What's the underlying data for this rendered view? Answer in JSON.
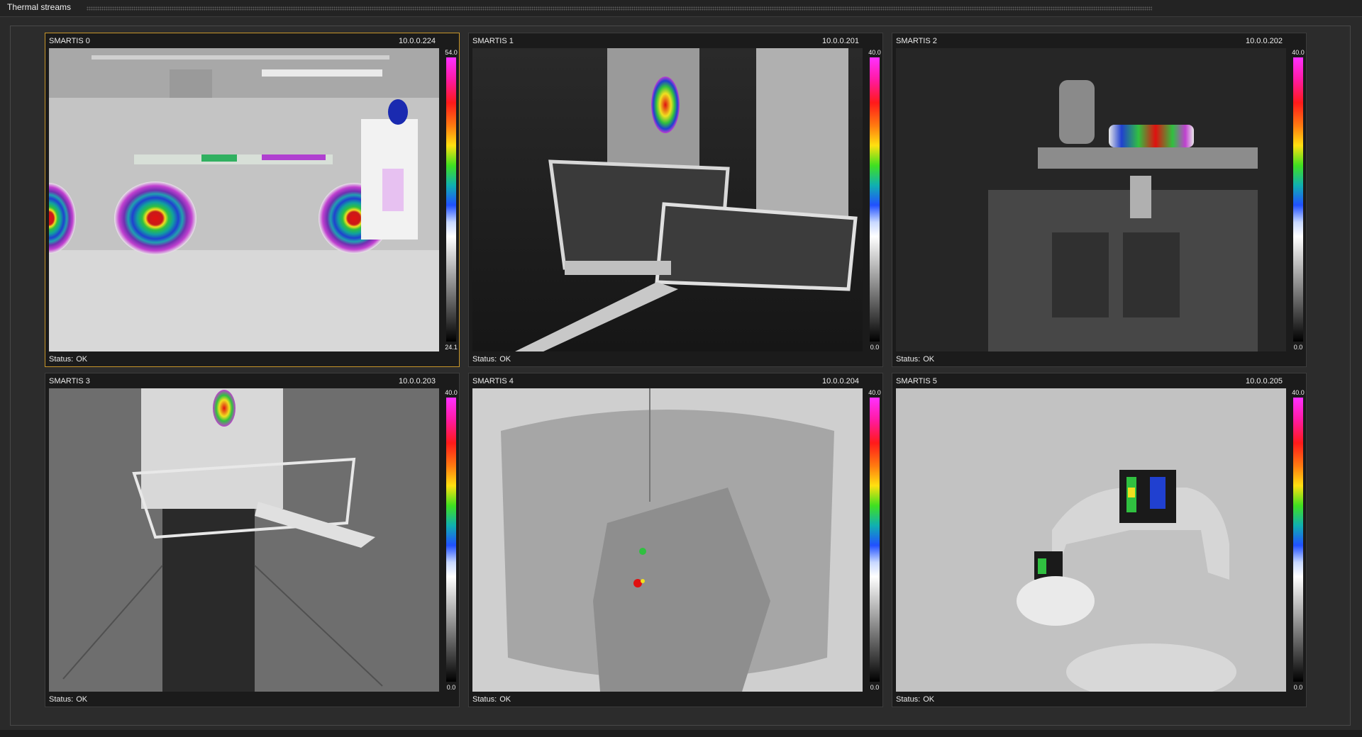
{
  "window": {
    "title": "Thermal streams"
  },
  "colors": {
    "selected_border": "#c8962a",
    "panel_background": "#1b1b1b",
    "frame_background": "#2c2c2c"
  },
  "cameras": [
    {
      "name": "SMARTIS 0",
      "ip": "10.0.0.224",
      "scale_max": "54.0",
      "scale_min": "24.1",
      "status_label": "Status:",
      "status_value": "OK",
      "selected": true
    },
    {
      "name": "SMARTIS 1",
      "ip": "10.0.0.201",
      "scale_max": "40.0",
      "scale_min": "0.0",
      "status_label": "Status:",
      "status_value": "OK",
      "selected": false
    },
    {
      "name": "SMARTIS 2",
      "ip": "10.0.0.202",
      "scale_max": "40.0",
      "scale_min": "0.0",
      "status_label": "Status:",
      "status_value": "OK",
      "selected": false
    },
    {
      "name": "SMARTIS 3",
      "ip": "10.0.0.203",
      "scale_max": "40.0",
      "scale_min": "0.0",
      "status_label": "Status:",
      "status_value": "OK",
      "selected": false
    },
    {
      "name": "SMARTIS 4",
      "ip": "10.0.0.204",
      "scale_max": "40.0",
      "scale_min": "0.0",
      "status_label": "Status:",
      "status_value": "OK",
      "selected": false
    },
    {
      "name": "SMARTIS 5",
      "ip": "10.0.0.205",
      "scale_max": "40.0",
      "scale_min": "0.0",
      "status_label": "Status:",
      "status_value": "OK",
      "selected": false
    }
  ]
}
